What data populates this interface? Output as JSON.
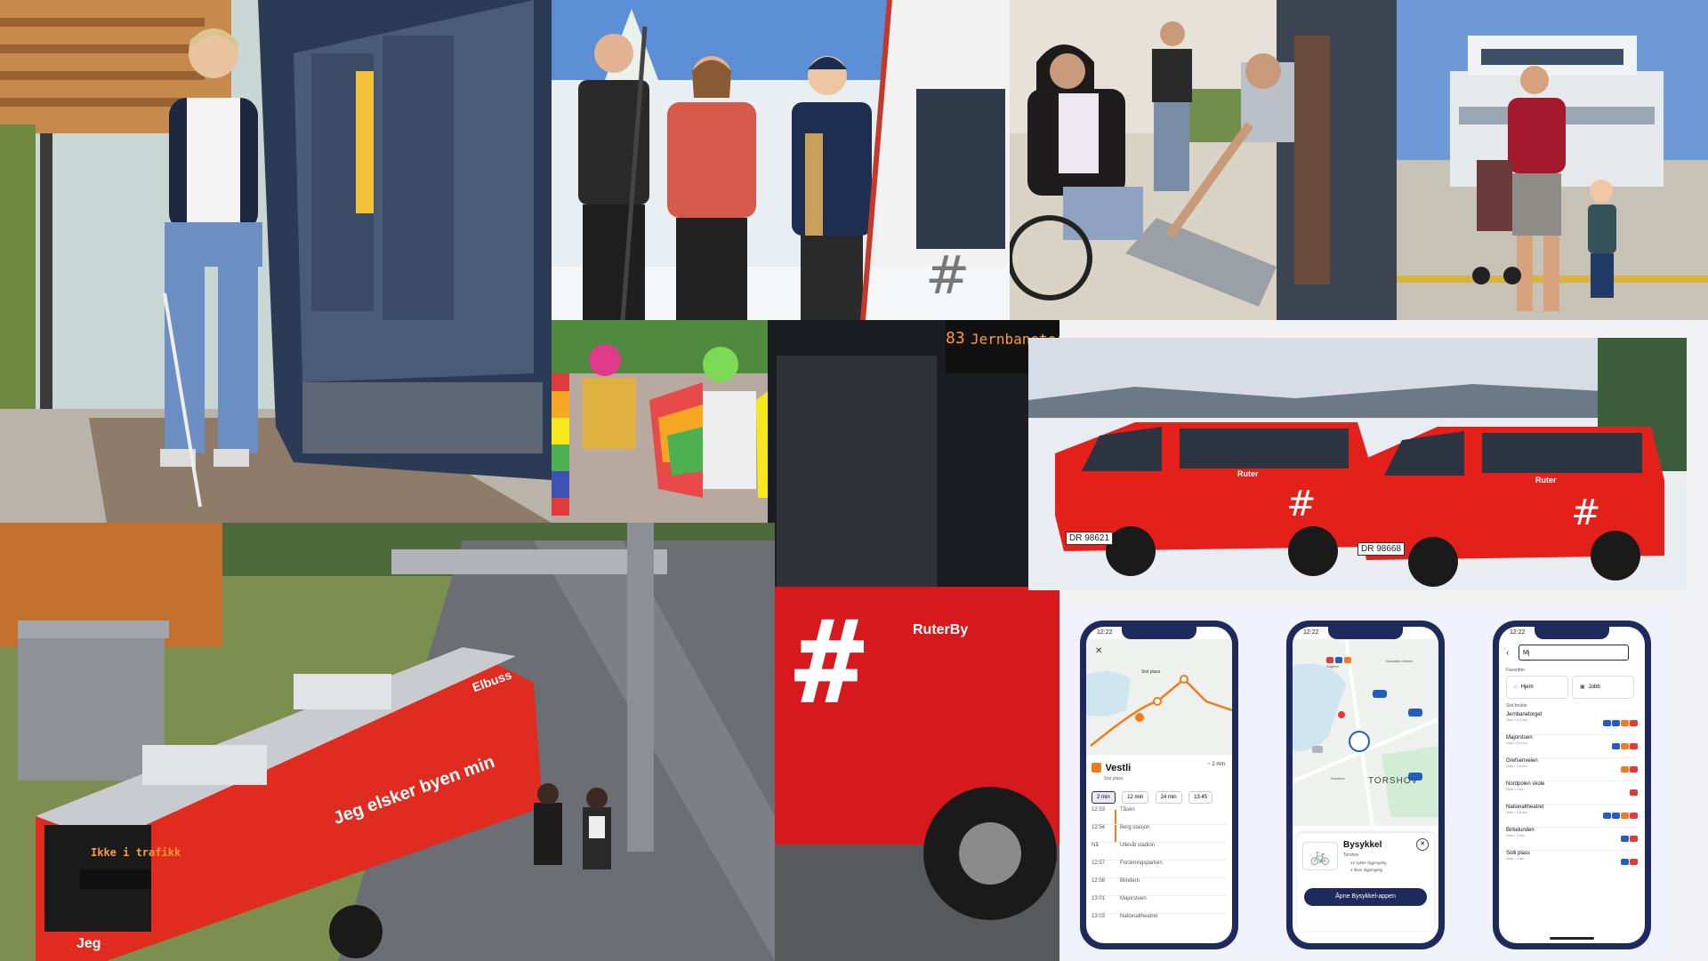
{
  "bus_tram": {
    "route_number": "83",
    "destination": "Jernbanetorget",
    "brand": "RuterBy"
  },
  "ebus": {
    "destination_display": "Ikke i trafikk",
    "roof_label": "Elbuss",
    "slogan_side": "Jeg elsker byen min",
    "slogan_rear": "Jeg"
  },
  "taxis": {
    "brand": "Ruter",
    "plate_1": "DR 98621",
    "plate_2": "DR 98668"
  },
  "phones": {
    "time": "12:22",
    "phone1": {
      "stop_name": "Vestli",
      "stop_sub": "Sist plass",
      "eta": "~ 2 min",
      "map_label": "Sist plass",
      "chips": [
        "2 min",
        "12 min",
        "24 min",
        "13:45"
      ],
      "departures": [
        {
          "time": "12:53",
          "stop": "Tåsen"
        },
        {
          "time": "12:54",
          "stop": "Berg stasjon"
        },
        {
          "time": "Nå",
          "stop": "Ullevål stadion"
        },
        {
          "time": "12:57",
          "stop": "Forskningsparken"
        },
        {
          "time": "12:58",
          "stop": "Blindern"
        },
        {
          "time": "13:01",
          "stop": "Majorstuen"
        },
        {
          "time": "13:03",
          "stop": "Nationaltheatret"
        }
      ]
    },
    "phone2": {
      "map_place": "TORSHOV",
      "place_top": "Sagene",
      "place_right": "Sandaker Senter",
      "card_title": "Bysykkel",
      "card_sub": "Torshov",
      "card_line1": "12 sykler tilgjengelig",
      "card_line2": "3 låser tilgjengelig",
      "button": "Åpne Bysykkel-appen",
      "map_marker": "Thorshov"
    },
    "phone3": {
      "search_value": "Mj",
      "favorites_heading": "Favoritter",
      "favorites": [
        "Hjem",
        "Jobb"
      ],
      "recent_heading": "Sist brukte",
      "recent": [
        {
          "name": "Jernbanetorget",
          "sub": "Oslo • 0.4 km"
        },
        {
          "name": "Majorstuen",
          "sub": "Oslo • 3.0 km"
        },
        {
          "name": "Grefsenveien",
          "sub": "Oslo • 2.8 km"
        },
        {
          "name": "Nordpolen skole",
          "sub": "Oslo • 2 km"
        },
        {
          "name": "Nationaltheatret",
          "sub": "Oslo • 0.8 km"
        },
        {
          "name": "Birkelunden",
          "sub": "Oslo • 2 km"
        },
        {
          "name": "Solli plass",
          "sub": "Oslo • 1 km"
        }
      ]
    }
  },
  "colors": {
    "ruter_red": "#e60000",
    "ruter_navy": "#1f2a5c",
    "route_orange": "#f07c1c"
  }
}
